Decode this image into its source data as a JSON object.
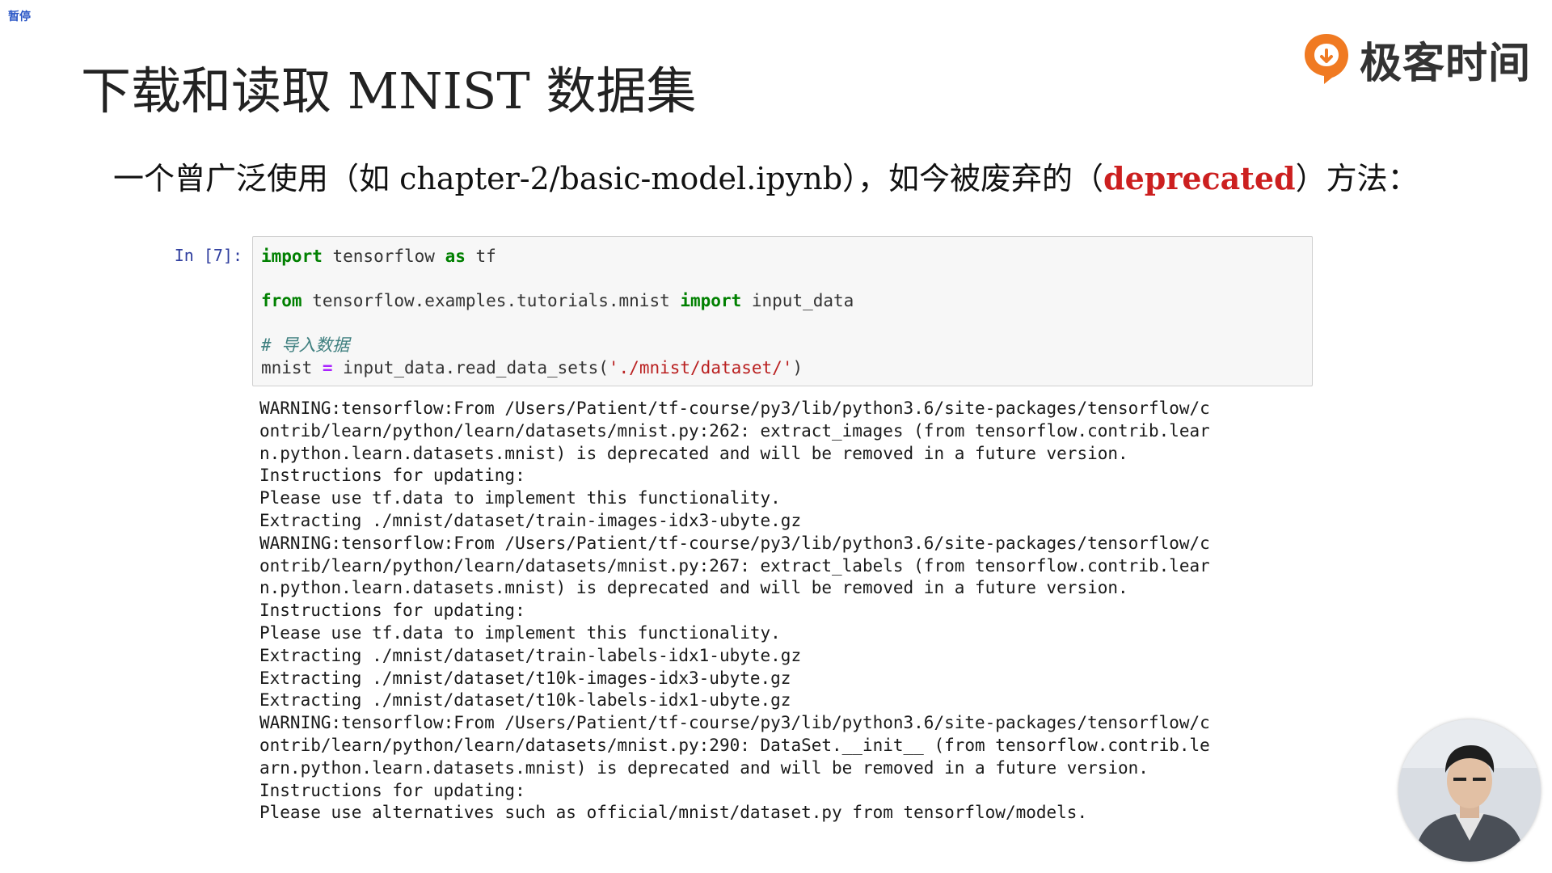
{
  "overlay": {
    "pause_label": "暂停"
  },
  "slide": {
    "title": "下载和读取 MNIST 数据集",
    "subtitle": {
      "prefix": "一个曾广泛使用（如 chapter-2/basic-model.ipynb），如今被废弃的（",
      "highlight": "deprecated",
      "suffix": "）方法："
    }
  },
  "brand": {
    "name": "极客时间",
    "accent_color": "#f07a22"
  },
  "notebook": {
    "prompt": "In [7]:",
    "code": {
      "line1": {
        "kw1": "import",
        "t1": " tensorflow ",
        "kw2": "as",
        "t2": " tf"
      },
      "line2": {
        "kw1": "from",
        "t1": " tensorflow.examples.tutorials.mnist ",
        "kw2": "import",
        "t2": " input_data"
      },
      "line3": {
        "comment": "# 导入数据"
      },
      "line4": {
        "t1": "mnist ",
        "op": "=",
        "t2": " input_data.read_data_sets(",
        "str": "'./mnist/dataset/'",
        "t3": ")"
      }
    },
    "output_lines": [
      "WARNING:tensorflow:From /Users/Patient/tf-course/py3/lib/python3.6/site-packages/tensorflow/c",
      "ontrib/learn/python/learn/datasets/mnist.py:262: extract_images (from tensorflow.contrib.lear",
      "n.python.learn.datasets.mnist) is deprecated and will be removed in a future version.",
      "Instructions for updating:",
      "Please use tf.data to implement this functionality.",
      "Extracting ./mnist/dataset/train-images-idx3-ubyte.gz",
      "WARNING:tensorflow:From /Users/Patient/tf-course/py3/lib/python3.6/site-packages/tensorflow/c",
      "ontrib/learn/python/learn/datasets/mnist.py:267: extract_labels (from tensorflow.contrib.lear",
      "n.python.learn.datasets.mnist) is deprecated and will be removed in a future version.",
      "Instructions for updating:",
      "Please use tf.data to implement this functionality.",
      "Extracting ./mnist/dataset/train-labels-idx1-ubyte.gz",
      "Extracting ./mnist/dataset/t10k-images-idx3-ubyte.gz",
      "Extracting ./mnist/dataset/t10k-labels-idx1-ubyte.gz",
      "WARNING:tensorflow:From /Users/Patient/tf-course/py3/lib/python3.6/site-packages/tensorflow/c",
      "ontrib/learn/python/learn/datasets/mnist.py:290: DataSet.__init__ (from tensorflow.contrib.le",
      "arn.python.learn.datasets.mnist) is deprecated and will be removed in a future version.",
      "Instructions for updating:",
      "Please use alternatives such as official/mnist/dataset.py from tensorflow/models."
    ]
  }
}
